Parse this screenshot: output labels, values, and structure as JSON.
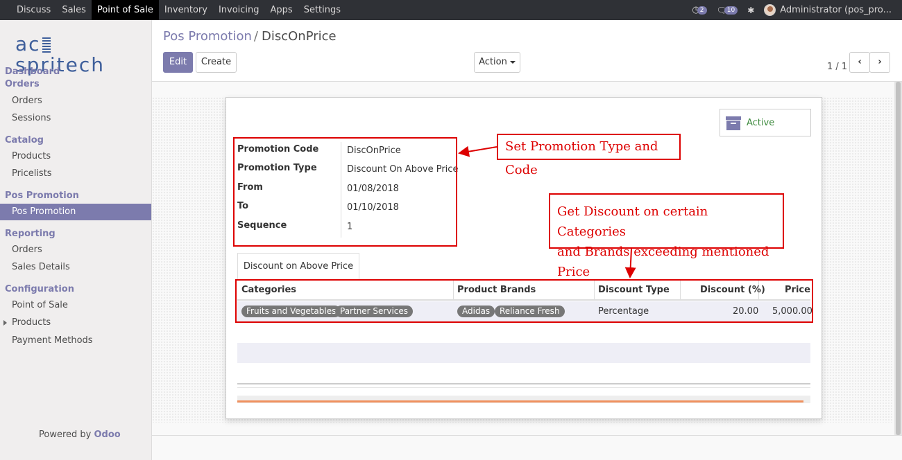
{
  "topbar": {
    "menu": [
      "Discuss",
      "Sales",
      "Point of Sale",
      "Inventory",
      "Invoicing",
      "Apps",
      "Settings"
    ],
    "active_menu": "Point of Sale",
    "activity_count": "2",
    "message_count": "10",
    "user": "Administrator (pos_pro..."
  },
  "sidebar": {
    "logo_left": "ac",
    "logo_right": "spritech",
    "sections": [
      {
        "label": "Dashboard"
      },
      {
        "label": "Orders",
        "items": [
          "Orders",
          "Sessions"
        ]
      },
      {
        "label": "Catalog",
        "items": [
          "Products",
          "Pricelists"
        ]
      },
      {
        "label": "Pos Promotion",
        "items": [
          "Pos Promotion"
        ]
      },
      {
        "label": "Reporting",
        "items": [
          "Orders",
          "Sales Details"
        ]
      },
      {
        "label": "Configuration",
        "items": [
          "Point of Sale",
          "Products",
          "Payment Methods"
        ]
      }
    ],
    "active_item": "Pos Promotion",
    "powered_by": "Powered by",
    "powered_brand": "Odoo"
  },
  "control_panel": {
    "breadcrumb_parent": "Pos Promotion",
    "breadcrumb_sep": "/",
    "breadcrumb_current": "DiscOnPrice",
    "edit_label": "Edit",
    "create_label": "Create",
    "action_label": "Action",
    "pager": "1 / 1"
  },
  "form": {
    "status_label": "Active",
    "fields": [
      {
        "label": "Promotion Code",
        "value": "DiscOnPrice"
      },
      {
        "label": "Promotion Type",
        "value": "Discount On Above Price"
      },
      {
        "label": "From",
        "value": "01/08/2018"
      },
      {
        "label": "To",
        "value": "01/10/2018"
      },
      {
        "label": "Sequence",
        "value": "1"
      }
    ],
    "tab_label": "Discount on Above Price",
    "table": {
      "columns": [
        "Categories",
        "Product Brands",
        "Discount Type",
        "Discount (%)",
        "Price"
      ],
      "row": {
        "categories": [
          "Fruits and Vegetables",
          "Partner Services"
        ],
        "brands": [
          "Adidas",
          "Reliance Fresh"
        ],
        "discount_type": "Percentage",
        "discount": "20.00",
        "price": "5,000.00"
      }
    }
  },
  "annotations": {
    "callout1": "Set Promotion Type and Code",
    "callout2_line1": "Get Discount on certain Categories",
    "callout2_line2": "and Brands exceeding mentioned Price"
  },
  "colors": {
    "accent": "#7c7bad",
    "topbar": "#2f3136",
    "annotation": "#dd0000",
    "active_status": "#3f8b3f"
  }
}
